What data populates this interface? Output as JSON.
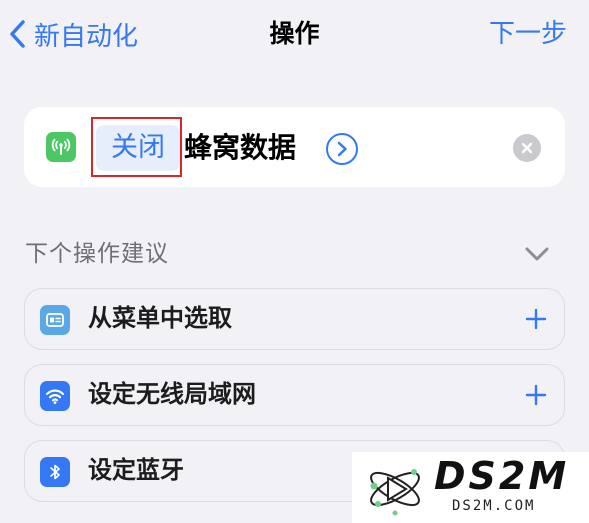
{
  "nav": {
    "back_label": "新自动化",
    "title": "操作",
    "next_label": "下一步"
  },
  "action": {
    "icon": "cellular-antenna-icon",
    "parameter": "关闭",
    "label": "蜂窝数据",
    "colors": {
      "icon_bg": "#4cc764",
      "accent": "#3478f6",
      "highlight": "#d9262b"
    }
  },
  "suggestions": {
    "title": "下个操作建议",
    "items": [
      {
        "label": "从菜单中选取",
        "icon": "menu-icon"
      },
      {
        "label": "设定无线局域网",
        "icon": "wifi-icon"
      },
      {
        "label": "设定蓝牙",
        "icon": "bluetooth-icon"
      }
    ]
  },
  "watermark": {
    "brand": "DS2M",
    "domain": "DS2M.COM"
  }
}
